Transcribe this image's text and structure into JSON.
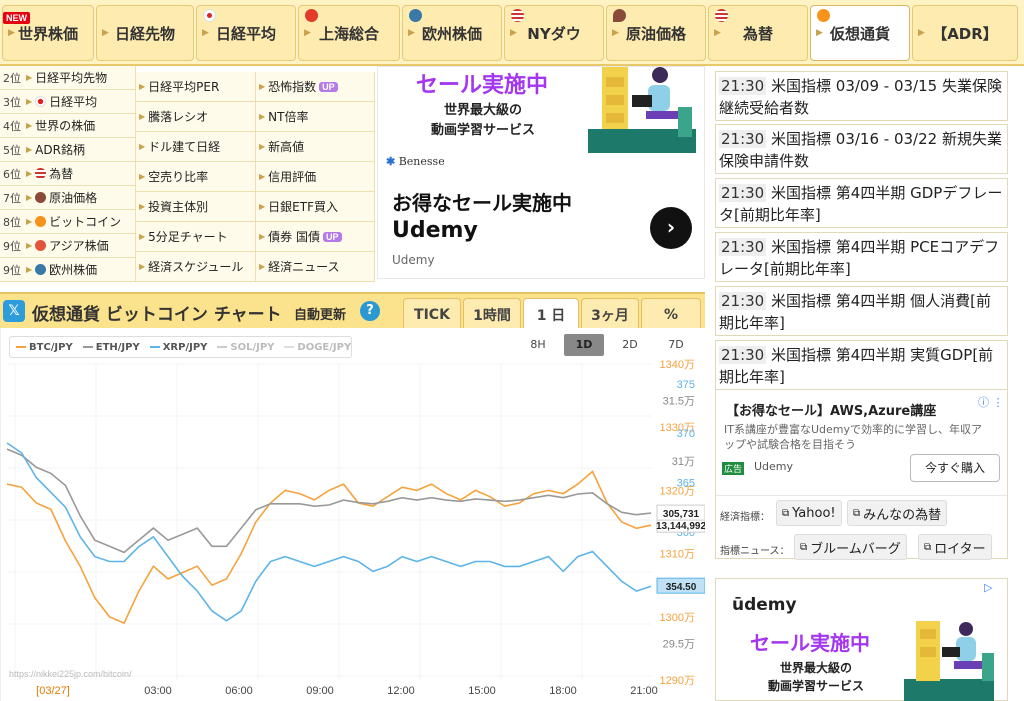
{
  "nav": {
    "tabs": [
      {
        "label": "世界株価",
        "badge": "NEW"
      },
      {
        "label": "日経先物"
      },
      {
        "label": "日経平均"
      },
      {
        "label": "上海総合"
      },
      {
        "label": "欧州株価"
      },
      {
        "label": "NYダウ"
      },
      {
        "label": "原油価格"
      },
      {
        "label": "為替"
      },
      {
        "label": "仮想通貨"
      },
      {
        "label": "【ADR】"
      }
    ]
  },
  "ranking": [
    {
      "rank": "2位",
      "label": "日経平均先物"
    },
    {
      "rank": "3位",
      "label": "日経平均"
    },
    {
      "rank": "4位",
      "label": "世界の株価"
    },
    {
      "rank": "5位",
      "label": "ADR銘柄"
    },
    {
      "rank": "6位",
      "label": "為替"
    },
    {
      "rank": "7位",
      "label": "原油価格"
    },
    {
      "rank": "8位",
      "label": "ビットコイン"
    },
    {
      "rank": "9位",
      "label": "アジア株価"
    },
    {
      "rank": "9位",
      "label": "欧州株価"
    }
  ],
  "links_col2": [
    "日経平均PER",
    "騰落レシオ",
    "ドル建て日経",
    "空売り比率",
    "投資主体別",
    "5分足チャート",
    "経済スケジュール"
  ],
  "links_col3": [
    {
      "label": "恐怖指数",
      "badge": "UP"
    },
    {
      "label": "NT倍率"
    },
    {
      "label": "新高値"
    },
    {
      "label": "信用評価"
    },
    {
      "label": "日銀ETF買入"
    },
    {
      "label": "債券 国債",
      "badge": "UP"
    },
    {
      "label": "経済ニュース"
    }
  ],
  "center_ad": {
    "sale": "セール実施中",
    "line1": "世界最大級の",
    "line2": "動画学習サービス",
    "brand": "Benesse",
    "title1": "お得なセール実施中",
    "title2": "Udemy",
    "source": "Udemy"
  },
  "chart_header": {
    "title": "仮想通貨 ビットコイン チャート",
    "auto_update": "自動更新",
    "help": "?",
    "tabs": [
      "TICK",
      "1時間",
      "1 日",
      "3ヶ月",
      "%"
    ]
  },
  "range_buttons": [
    "8H",
    "1D",
    "2D",
    "7D"
  ],
  "colors": {
    "btc": "#f5a23c",
    "eth": "#999999",
    "xrp": "#5db4e8",
    "sol": "#cccccc",
    "doge": "#dddddd"
  },
  "chart_data": {
    "type": "line",
    "legend": [
      "BTC/JPY",
      "ETH/JPY",
      "XRP/JPY",
      "SOL/JPY",
      "DOGE/JPY"
    ],
    "x_ticks": [
      "[03/27]",
      "03:00",
      "06:00",
      "09:00",
      "12:00",
      "15:00",
      "18:00",
      "21:00"
    ],
    "btc_axis": {
      "ticks": [
        "1340万",
        "1330万",
        "1320万",
        "1310万",
        "1300万",
        "1290万"
      ],
      "ylim": [
        12900000,
        13400000
      ]
    },
    "eth_axis": {
      "ticks": [
        "31.5万",
        "31万",
        "30万",
        "29.5万"
      ],
      "ylim": [
        292000,
        318000
      ]
    },
    "xrp_axis": {
      "ticks": [
        "375",
        "370",
        "365",
        "360",
        "355"
      ],
      "ylim": [
        345,
        377
      ]
    },
    "last_labels": {
      "btc": "13,144,992",
      "eth": "305,731",
      "xrp": "354.50"
    },
    "watermark": "https://nikkei225jp.com/bitcoin/",
    "series": [
      {
        "name": "BTC/JPY",
        "values": [
          13210000,
          13205000,
          13180000,
          13170000,
          13120000,
          13080000,
          13030000,
          13000000,
          12990000,
          13040000,
          13080000,
          13060000,
          13070000,
          13080000,
          13050000,
          13060000,
          13100000,
          13150000,
          13180000,
          13200000,
          13195000,
          13185000,
          13200000,
          13210000,
          13180000,
          13175000,
          13190000,
          13205000,
          13200000,
          13210000,
          13195000,
          13185000,
          13200000,
          13190000,
          13175000,
          13180000,
          13195000,
          13200000,
          13195000,
          13210000,
          13230000,
          13180000,
          13150000,
          13140000,
          13145000
        ]
      },
      {
        "name": "ETH/JPY",
        "values": [
          311000,
          310500,
          309500,
          309000,
          308000,
          305500,
          303500,
          303000,
          302500,
          303500,
          304500,
          303500,
          304000,
          304500,
          303000,
          303000,
          304500,
          306000,
          306500,
          306500,
          306500,
          306300,
          306400,
          306800,
          306600,
          306500,
          306700,
          307000,
          306800,
          307000,
          306800,
          306700,
          306900,
          306800,
          306700,
          306800,
          307000,
          307200,
          307000,
          307300,
          307400,
          306500,
          305800,
          305600,
          305731
        ]
      },
      {
        "name": "XRP/JPY",
        "values": [
          369,
          368,
          365.5,
          364,
          362.5,
          359.5,
          357.5,
          357,
          357,
          358.5,
          359.5,
          357.5,
          355.5,
          354,
          352,
          351,
          352,
          355,
          357,
          357.5,
          357,
          356.5,
          357,
          357.5,
          357,
          356,
          356.5,
          357.5,
          357,
          357.5,
          357,
          356.5,
          357,
          357,
          356.5,
          356.5,
          357,
          357.5,
          356,
          357.5,
          358,
          356.5,
          355,
          354,
          354.5
        ]
      }
    ]
  },
  "news": [
    {
      "time": "21:30",
      "text": "米国指標 03/09 - 03/15 失業保険継続受給者数"
    },
    {
      "time": "21:30",
      "text": "米国指標 03/16 - 03/22 新規失業保険申請件数"
    },
    {
      "time": "21:30",
      "text": "米国指標 第4四半期 GDPデフレータ[前期比年率]"
    },
    {
      "time": "21:30",
      "text": "米国指標 第4四半期 PCEコアデフレータ[前期比年率]"
    },
    {
      "time": "21:30",
      "text": "米国指標 第4四半期 個人消費[前期比年率]"
    },
    {
      "time": "21:30",
      "text": "米国指標 第4四半期 実質GDP[前期比年率]"
    }
  ],
  "side_ad": {
    "title": "【お得なセール】AWS,Azure講座",
    "desc": "IT系講座が豊富なUdemyで効率的に学習し、年収アップや試験合格を目指そう",
    "badge": "広告",
    "source": "Udemy",
    "button": "今すぐ購入"
  },
  "ext_links": {
    "econ_label": "経済指標：",
    "econ": [
      "Yahoo!",
      "みんなの為替"
    ],
    "news_label": "指標ニュース：",
    "news": [
      "ブルームバーグ",
      "ロイター"
    ]
  },
  "bottom_ad": {
    "brand": "ūdemy",
    "sale": "セール実施中",
    "line1": "世界最大級の",
    "line2": "動画学習サービス"
  }
}
